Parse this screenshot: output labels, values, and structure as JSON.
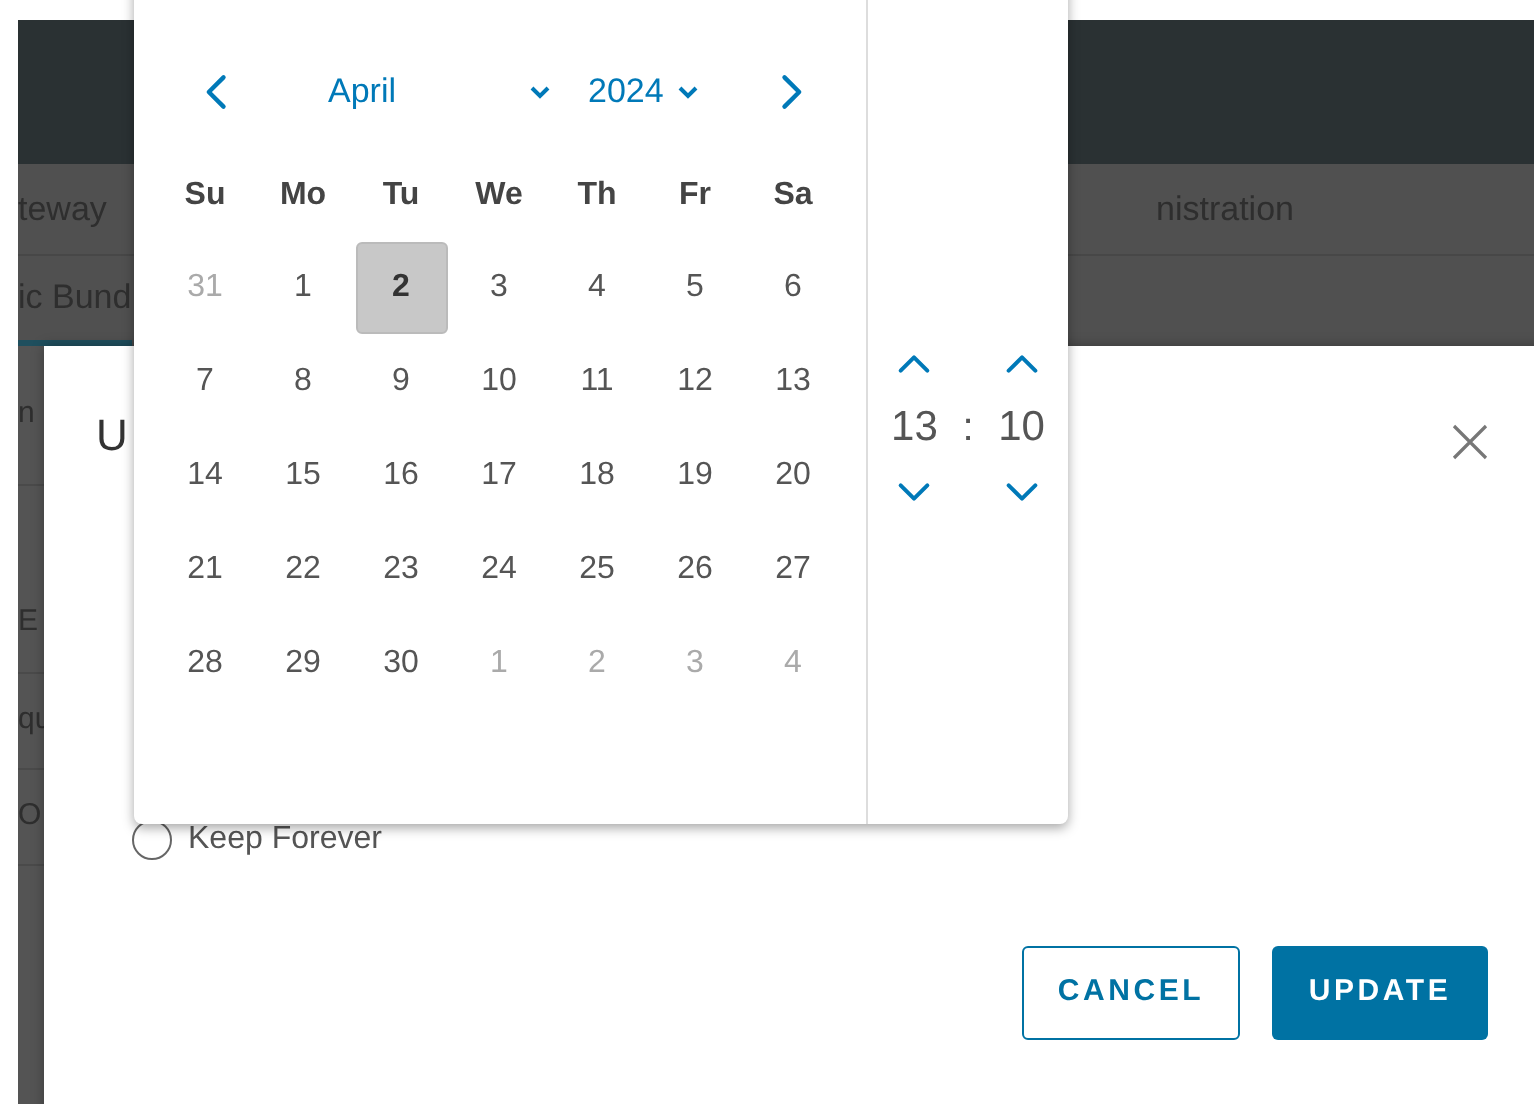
{
  "background": {
    "nav_tabs": [
      {
        "label": "teway"
      },
      {
        "label": "nistration"
      }
    ],
    "sub_tab": {
      "label": "ic Bund",
      "selected": true
    },
    "rows": [
      "n",
      "E",
      "qu",
      "O"
    ]
  },
  "dialog": {
    "title": "U",
    "options": [
      {
        "label": "Keep Forever",
        "selected": false
      }
    ],
    "buttons": [
      {
        "label": "CANCEL",
        "kind": "outline"
      },
      {
        "label": "UPDATE",
        "kind": "primary"
      }
    ]
  },
  "datepicker": {
    "month": "April",
    "year": "2024",
    "weekdays": [
      "Su",
      "Mo",
      "Tu",
      "We",
      "Th",
      "Fr",
      "Sa"
    ],
    "weeks": [
      [
        {
          "day": "31",
          "outside": true,
          "selected": false
        },
        {
          "day": "1",
          "outside": false,
          "selected": false
        },
        {
          "day": "2",
          "outside": false,
          "selected": true
        },
        {
          "day": "3",
          "outside": false,
          "selected": false
        },
        {
          "day": "4",
          "outside": false,
          "selected": false
        },
        {
          "day": "5",
          "outside": false,
          "selected": false
        },
        {
          "day": "6",
          "outside": false,
          "selected": false
        }
      ],
      [
        {
          "day": "7",
          "outside": false,
          "selected": false
        },
        {
          "day": "8",
          "outside": false,
          "selected": false
        },
        {
          "day": "9",
          "outside": false,
          "selected": false
        },
        {
          "day": "10",
          "outside": false,
          "selected": false
        },
        {
          "day": "11",
          "outside": false,
          "selected": false
        },
        {
          "day": "12",
          "outside": false,
          "selected": false
        },
        {
          "day": "13",
          "outside": false,
          "selected": false
        }
      ],
      [
        {
          "day": "14",
          "outside": false,
          "selected": false
        },
        {
          "day": "15",
          "outside": false,
          "selected": false
        },
        {
          "day": "16",
          "outside": false,
          "selected": false
        },
        {
          "day": "17",
          "outside": false,
          "selected": false
        },
        {
          "day": "18",
          "outside": false,
          "selected": false
        },
        {
          "day": "19",
          "outside": false,
          "selected": false
        },
        {
          "day": "20",
          "outside": false,
          "selected": false
        }
      ],
      [
        {
          "day": "21",
          "outside": false,
          "selected": false
        },
        {
          "day": "22",
          "outside": false,
          "selected": false
        },
        {
          "day": "23",
          "outside": false,
          "selected": false
        },
        {
          "day": "24",
          "outside": false,
          "selected": false
        },
        {
          "day": "25",
          "outside": false,
          "selected": false
        },
        {
          "day": "26",
          "outside": false,
          "selected": false
        },
        {
          "day": "27",
          "outside": false,
          "selected": false
        }
      ],
      [
        {
          "day": "28",
          "outside": false,
          "selected": false
        },
        {
          "day": "29",
          "outside": false,
          "selected": false
        },
        {
          "day": "30",
          "outside": false,
          "selected": false
        },
        {
          "day": "1",
          "outside": true,
          "selected": false
        },
        {
          "day": "2",
          "outside": true,
          "selected": false
        },
        {
          "day": "3",
          "outside": true,
          "selected": false
        },
        {
          "day": "4",
          "outside": true,
          "selected": false
        }
      ]
    ],
    "hour": "13",
    "separator": ":",
    "minute": "10"
  }
}
